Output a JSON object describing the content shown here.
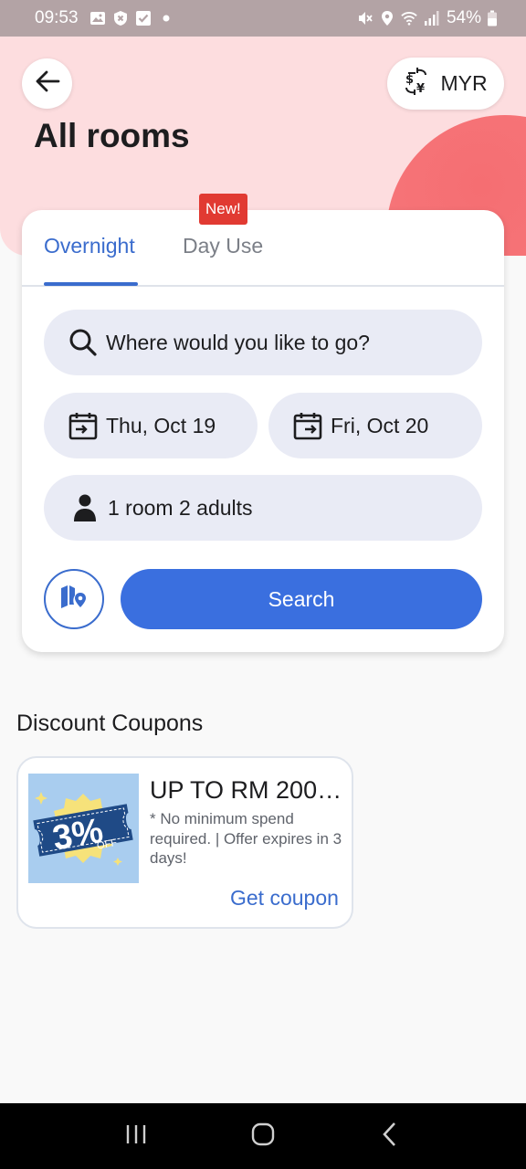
{
  "status_bar": {
    "time": "09:53",
    "battery": "54%",
    "icons": [
      "image-icon",
      "shield-x-icon",
      "check-box-icon",
      "dot-icon",
      "mute-icon",
      "location-icon",
      "wifi-icon",
      "signal-icon",
      "battery-icon"
    ]
  },
  "header": {
    "title": "All rooms",
    "currency": "MYR",
    "back_icon": "arrow-left-icon",
    "currency_icon": "currency-exchange-icon"
  },
  "tabs": {
    "overnight": "Overnight",
    "day_use": "Day Use",
    "new_badge": "New!",
    "active": "Overnight"
  },
  "search": {
    "destination_placeholder": "Where would you like to go?",
    "check_in": "Thu, Oct 19",
    "check_out": "Fri, Oct 20",
    "occupancy": "1 room 2 adults",
    "search_button": "Search",
    "map_icon": "map-pin-icon"
  },
  "coupons": {
    "section_title": "Discount Coupons",
    "items": [
      {
        "badge_value": "3%",
        "badge_sub": "OFF",
        "title": "UP TO RM 200 …",
        "description": "* No minimum spend required.  | Offer expires in 3 days!",
        "action": "Get coupon"
      }
    ]
  },
  "colors": {
    "accent": "#3a6fdf",
    "hero_bg": "#fddddf",
    "hero_circle": "#f56e72",
    "badge_red": "#e13a32"
  }
}
